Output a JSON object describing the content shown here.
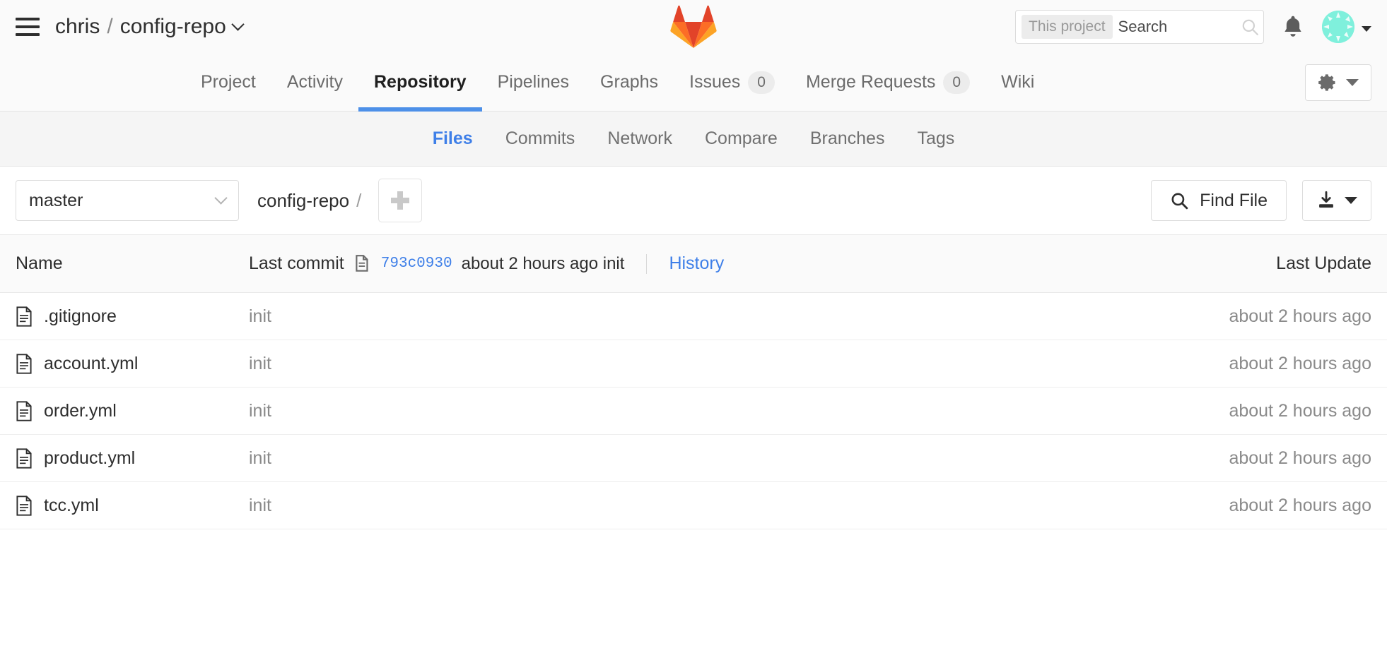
{
  "header": {
    "menu_icon": "hamburger-menu-icon",
    "namespace": "chris",
    "separator": "/",
    "project": "config-repo",
    "logo_icon": "gitlab-logo-icon",
    "search": {
      "scope_label": "This project",
      "placeholder": "Search",
      "value": "",
      "icon": "search-icon"
    },
    "notifications_icon": "bell-icon",
    "avatar_icon": "user-avatar",
    "avatar_caret_icon": "caret-down-icon"
  },
  "nav": {
    "tabs": [
      {
        "label": "Project",
        "active": false,
        "count": null
      },
      {
        "label": "Activity",
        "active": false,
        "count": null
      },
      {
        "label": "Repository",
        "active": true,
        "count": null
      },
      {
        "label": "Pipelines",
        "active": false,
        "count": null
      },
      {
        "label": "Graphs",
        "active": false,
        "count": null
      },
      {
        "label": "Issues",
        "active": false,
        "count": "0"
      },
      {
        "label": "Merge Requests",
        "active": false,
        "count": "0"
      },
      {
        "label": "Wiki",
        "active": false,
        "count": null
      }
    ],
    "settings_icon": "gear-icon",
    "settings_caret_icon": "caret-down-icon"
  },
  "subnav": {
    "items": [
      {
        "label": "Files",
        "active": true
      },
      {
        "label": "Commits",
        "active": false
      },
      {
        "label": "Network",
        "active": false
      },
      {
        "label": "Compare",
        "active": false
      },
      {
        "label": "Branches",
        "active": false
      },
      {
        "label": "Tags",
        "active": false
      }
    ]
  },
  "toolbar": {
    "branch": "master",
    "branch_caret_icon": "chevron-down-icon",
    "breadcrumb_root": "config-repo",
    "breadcrumb_sep": "/",
    "add_button_icon": "plus-icon",
    "find_file_label": "Find File",
    "find_file_icon": "search-icon",
    "download_icon": "download-icon",
    "download_caret_icon": "caret-down-icon"
  },
  "table": {
    "columns": {
      "name": "Name",
      "last_commit": "Last commit",
      "last_update": "Last Update"
    },
    "header_commit": {
      "copy_icon": "copy-icon",
      "sha": "793c0930",
      "time_and_message": "about 2 hours ago init",
      "history_label": "History"
    },
    "rows": [
      {
        "icon": "file-document-icon",
        "name": ".gitignore",
        "commit": "init",
        "updated": "about 2 hours ago"
      },
      {
        "icon": "file-document-icon",
        "name": "account.yml",
        "commit": "init",
        "updated": "about 2 hours ago"
      },
      {
        "icon": "file-document-icon",
        "name": "order.yml",
        "commit": "init",
        "updated": "about 2 hours ago"
      },
      {
        "icon": "file-document-icon",
        "name": "product.yml",
        "commit": "init",
        "updated": "about 2 hours ago"
      },
      {
        "icon": "file-document-icon",
        "name": "tcc.yml",
        "commit": "init",
        "updated": "about 2 hours ago"
      }
    ]
  },
  "colors": {
    "accent_blue": "#3e7fe8",
    "active_tab_bar": "#4d90e8",
    "logo_orange": "#fc6d26",
    "logo_red": "#e24329",
    "avatar_teal": "#7ff0dc"
  }
}
